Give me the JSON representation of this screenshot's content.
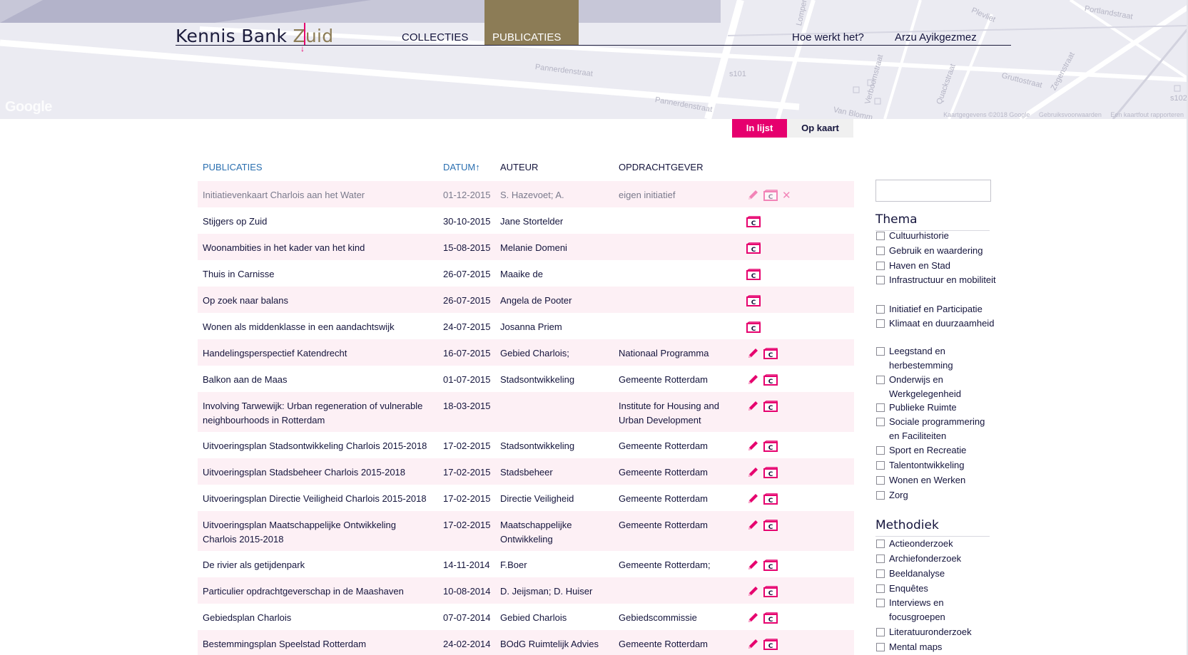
{
  "app": {
    "brand_main": "Kennis Bank ",
    "brand_accent": "Zuid"
  },
  "nav": {
    "collecties": "COLLECTIES",
    "publicaties": "PUBLICATIES",
    "hoe": "Hoe werkt het?",
    "user": "Arzu Ayikgezmez"
  },
  "map": {
    "google": "Google",
    "attribution": [
      "Kaartgegevens ©2018 Google",
      "Gebruiksvoorwaarden",
      "Een kaartfout rapporteren"
    ],
    "streets": [
      "Portlandstraat",
      "Pannerdenstraat",
      "Pannerdenstraat",
      "Gruttostraat",
      "Zegenstraat",
      "Quackstraat",
      "Verboomstraat",
      "Van Blomm",
      "Plevliet",
      "Lompert",
      "s101",
      "s102"
    ]
  },
  "view": {
    "list": "In lijst",
    "map": "Op kaart"
  },
  "table": {
    "headers": {
      "publicaties": "PUBLICATIES",
      "datum": "DATUM",
      "sort_arrow": "↑",
      "auteur": "AUTEUR",
      "opdrachtgever": "OPDRACHTGEVER"
    },
    "rows": [
      {
        "title": "Initiatievenkaart Charlois aan het Water",
        "date": "01-12-2015",
        "author": "S. Hazevoet; A.",
        "client": "eigen initiatief"
      },
      {
        "title": "Stijgers op Zuid",
        "date": "30-10-2015",
        "author": "Jane Stortelder",
        "client": ""
      },
      {
        "title": "Woonambities in het kader van het kind",
        "date": "15-08-2015",
        "author": "Melanie Domeni",
        "client": ""
      },
      {
        "title": "Thuis in Carnisse",
        "date": "26-07-2015",
        "author": "Maaike de",
        "client": ""
      },
      {
        "title": "Op zoek naar balans",
        "date": "26-07-2015",
        "author": "Angela de Pooter",
        "client": ""
      },
      {
        "title": "Wonen als middenklasse in een aandachtswijk",
        "date": "24-07-2015",
        "author": "Josanna Priem",
        "client": ""
      },
      {
        "title": "Handelingsperspectief Katendrecht",
        "date": "16-07-2015",
        "author": "Gebied Charlois;",
        "client": "Nationaal Programma"
      },
      {
        "title": "Balkon aan de Maas",
        "date": "01-07-2015",
        "author": "Stadsontwikkeling",
        "client": "Gemeente Rotterdam"
      },
      {
        "title": "Involving Tarwewijk: Urban regeneration of vulnerable neighbourhoods in Rotterdam",
        "date": "18-03-2015",
        "author": "",
        "client": "Institute for Housing and Urban Development"
      },
      {
        "title": "Uitvoeringsplan Stadsontwikkeling Charlois 2015-2018",
        "date": "17-02-2015",
        "author": "Stadsontwikkeling",
        "client": "Gemeente Rotterdam"
      },
      {
        "title": "Uitvoeringsplan Stadsbeheer Charlois 2015-2018",
        "date": "17-02-2015",
        "author": "Stadsbeheer",
        "client": "Gemeente Rotterdam"
      },
      {
        "title": "Uitvoeringsplan Directie Veiligheid Charlois 2015-2018",
        "date": "17-02-2015",
        "author": "Directie Veiligheid",
        "client": "Gemeente Rotterdam"
      },
      {
        "title": "Uitvoeringsplan Maatschappelijke Ontwikkeling Charlois 2015-2018",
        "date": "17-02-2015",
        "author": "Maatschappelijke Ontwikkeling",
        "client": "Gemeente Rotterdam"
      },
      {
        "title": "De rivier als getijdenpark",
        "date": "14-11-2014",
        "author": "F.Boer",
        "client": "Gemeente Rotterdam;"
      },
      {
        "title": "Particulier opdrachtgeverschap in de Maashaven",
        "date": "10-08-2014",
        "author": "D. Jeijsman; D. Huiser",
        "client": ""
      },
      {
        "title": "Gebiedsplan Charlois",
        "date": "07-07-2014",
        "author": "Gebied Charlois",
        "client": "Gebiedscommissie"
      },
      {
        "title": "Bestemmingsplan Speelstad Rotterdam",
        "date": "24-02-2014",
        "author": "BOdG Ruimtelijk Advies",
        "client": "Gemeente Rotterdam"
      }
    ]
  },
  "filters": {
    "thema_title": "Thema",
    "thema": [
      "Cultuurhistorie",
      "Gebruik en waardering",
      "Haven en Stad",
      "Infrastructuur en mobiliteit",
      "Initiatief en Participatie",
      "Klimaat en duurzaamheid",
      "Leegstand en herbestemming",
      "Onderwijs en Werkgelegenheid",
      "Publieke Ruimte",
      "Sociale programmering en Faciliteiten",
      "Sport en Recreatie",
      "Talentontwikkeling",
      "Wonen en Werken",
      "Zorg"
    ],
    "methodiek_title": "Methodiek",
    "methodiek": [
      "Actieonderzoek",
      "Archiefonderzoek",
      "Beeldanalyse",
      "Enquêtes",
      "Interviews en focusgroepen",
      "Literatuuronderzoek",
      "Mental maps"
    ]
  },
  "colors": {
    "accent": "#e6006e",
    "gold": "#8c7c56",
    "navy": "#14143c",
    "link_blue": "#2a6fb0",
    "row_alt": "#fdf0f5"
  }
}
